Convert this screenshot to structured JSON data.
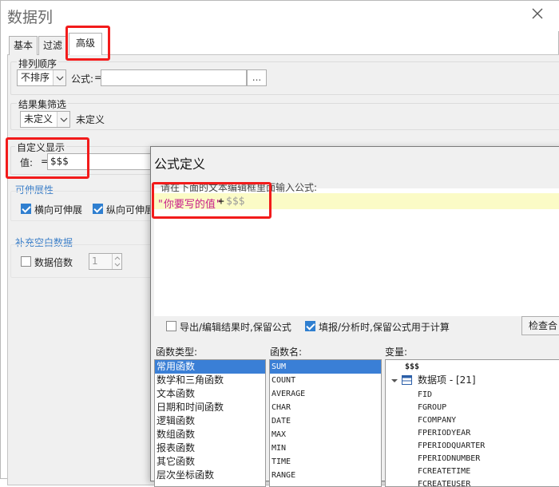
{
  "main_dialog": {
    "title": "数据列",
    "tabs": [
      "基本",
      "过滤",
      "高级"
    ]
  },
  "sort": {
    "group_label": "排列顺序",
    "combo_value": "不排序",
    "formula_label": "公式:",
    "formula_prefix": "=",
    "formula_button": "..."
  },
  "result_filter": {
    "group_label": "结果集筛选",
    "combo_value": "未定义",
    "value_text": "未定义"
  },
  "custom_display": {
    "group_label": "自定义显示",
    "value_label": "值:",
    "value_prefix": "=",
    "value": "$$$"
  },
  "expand": {
    "section_label": "可伸展性",
    "horizontal": "横向可伸展",
    "vertical": "纵向可伸展"
  },
  "fill_blank": {
    "section_label": "补充空白数据",
    "multiple_label": "数据倍数",
    "multiple_value": "1"
  },
  "formula_dialog": {
    "title": "公式定义",
    "hint": "请在下面的文本编辑框里面输入公式:",
    "formula_string": "\"你要写的值\"",
    "formula_plus": "+",
    "formula_var": "$$$",
    "export_keep_label": "导出/编辑结果时,保留公式",
    "fill_keep_label": "填报/分析时,保留公式用于计算",
    "check_button": "检查合",
    "func_type_label": "函数类型:",
    "func_name_label": "函数名:",
    "var_label": "变量:",
    "func_types": [
      "常用函数",
      "数学和三角函数",
      "文本函数",
      "日期和时间函数",
      "逻辑函数",
      "数组函数",
      "报表函数",
      "其它函数",
      "层次坐标函数"
    ],
    "func_names": [
      "SUM",
      "COUNT",
      "AVERAGE",
      "CHAR",
      "DATE",
      "MAX",
      "MIN",
      "TIME",
      "RANGE"
    ],
    "var_top": "$$$",
    "var_group": "数据项 - [21]",
    "var_fields": [
      "FID",
      "FGROUP",
      "FCOMPANY",
      "FPERIODYEAR",
      "FPERIODQUARTER",
      "FPERIODNUMBER",
      "FCREATETIME",
      "FCREATEUSER"
    ]
  },
  "colors": {
    "highlight": "#f21b1b",
    "selection": "#3a7fd6",
    "section_blue": "#3c7fc8",
    "formula_string": "#c81e8a",
    "formula_line": "#fbfbc6"
  }
}
